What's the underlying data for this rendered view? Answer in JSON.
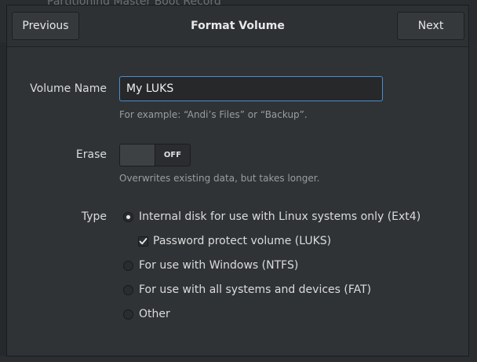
{
  "backdrop": {
    "breadcrumb": "Partitioning   Master Boot Record"
  },
  "header": {
    "previous_label": "Previous",
    "title": "Format Volume",
    "next_label": "Next"
  },
  "volume_name": {
    "label": "Volume Name",
    "value": "My LUKS",
    "hint": "For example: “Andi’s Files” or “Backup”."
  },
  "erase": {
    "label": "Erase",
    "state": "OFF",
    "hint": "Overwrites existing data, but takes longer."
  },
  "type": {
    "label": "Type",
    "options": [
      {
        "label": "Internal disk for use with Linux systems only (Ext4)",
        "selected": true
      },
      {
        "label": "For use with Windows (NTFS)",
        "selected": false
      },
      {
        "label": "For use with all systems and devices (FAT)",
        "selected": false
      },
      {
        "label": "Other",
        "selected": false
      }
    ],
    "password_protect": {
      "label": "Password protect volume (LUKS)",
      "checked": true
    }
  },
  "colors": {
    "accent": "#4a8ed0",
    "background": "#303336"
  }
}
